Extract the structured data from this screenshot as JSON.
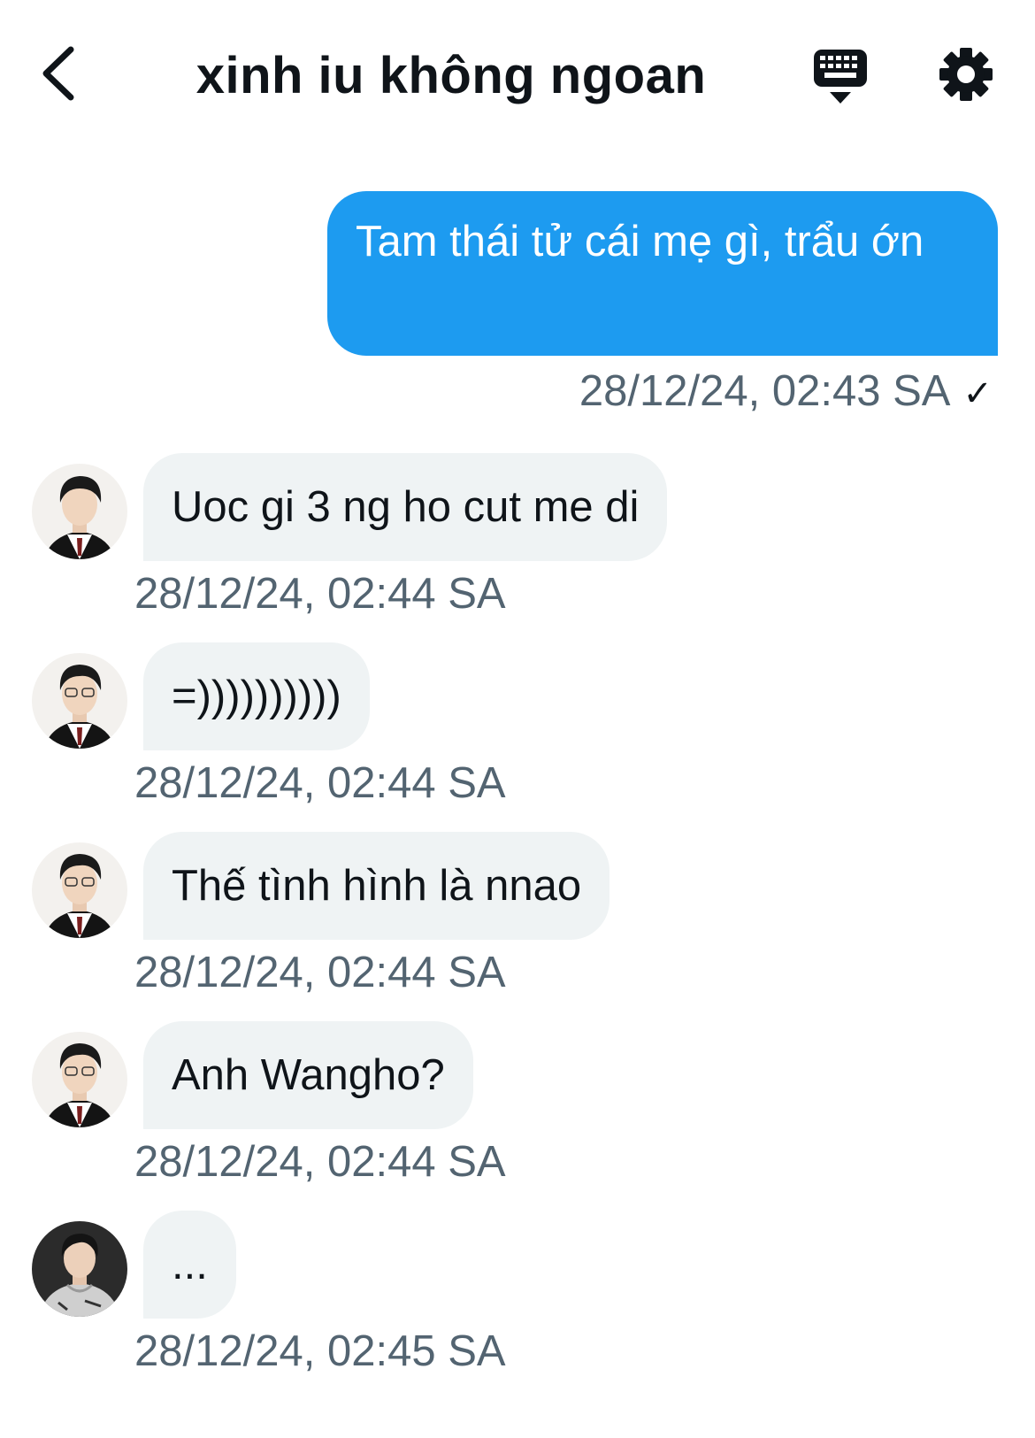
{
  "header": {
    "title": "xinh iu không ngoan",
    "back_icon": "chevron-left-icon",
    "keyboard_icon": "keyboard-icon",
    "settings_icon": "gear-icon"
  },
  "colors": {
    "accent": "#1d9bf0",
    "incoming_bubble": "#eff3f4",
    "timestamp": "#536471"
  },
  "messages": [
    {
      "direction": "outgoing",
      "text": "Tam thái tử cái mẹ gì, trẩu ớn",
      "time": "28/12/24, 02:43 SA",
      "status_icon": "check-icon"
    },
    {
      "direction": "incoming",
      "text": "Uoc gi 3 ng ho cut me di",
      "time": "28/12/24, 02:44 SA"
    },
    {
      "direction": "incoming",
      "text": "=))))))))))",
      "time": "28/12/24, 02:44 SA"
    },
    {
      "direction": "incoming",
      "text": "Thế tình hình là nnao",
      "time": "28/12/24, 02:44 SA"
    },
    {
      "direction": "incoming",
      "text": "Anh Wangho?",
      "time": "28/12/24, 02:44 SA"
    },
    {
      "direction": "incoming",
      "text": "...",
      "time": "28/12/24, 02:45 SA"
    }
  ]
}
